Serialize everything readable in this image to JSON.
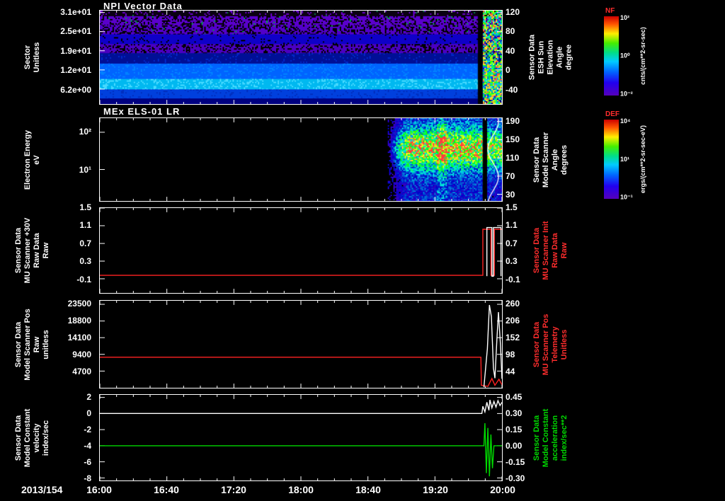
{
  "x_axis": {
    "date_label": "2013/154",
    "tick_labels": [
      "16:00",
      "16:40",
      "17:20",
      "18:00",
      "18:40",
      "19:20",
      "20:00"
    ],
    "start_hour": 16,
    "end_hour": 20
  },
  "colors": {
    "background": "#000000",
    "axis": "#ffffff",
    "red_label": "#ff2d2d",
    "green_label": "#00d800"
  },
  "colorbars": [
    {
      "name": "NF",
      "unit": "cnts/(cm**2-sr-sec)",
      "ticks": [
        {
          "label": "10²",
          "pos": 0.02
        },
        {
          "label": "10⁰",
          "pos": 0.5
        },
        {
          "label": "10⁻²",
          "pos": 0.98
        }
      ]
    },
    {
      "name": "DEF",
      "unit": "ergs/(cm**2-sr-sec-eV)",
      "ticks": [
        {
          "label": "10⁴",
          "pos": 0.02
        },
        {
          "label": "10¹",
          "pos": 0.5
        },
        {
          "label": "10⁻¹",
          "pos": 0.98
        }
      ]
    }
  ],
  "chart_data": [
    {
      "type": "heatmap",
      "title": "NPI Vector Data",
      "ylabel_lines": [
        "Sector",
        "Unitless"
      ],
      "right_label_lines": [
        "Sensor Data",
        "ESH Sun",
        "Elevation",
        "Angle",
        "degree"
      ],
      "right_color": "#ffffff",
      "left_ticks": [
        {
          "label": "3.1e+01",
          "pos": 0.02
        },
        {
          "label": "2.5e+01",
          "pos": 0.225
        },
        {
          "label": "1.9e+01",
          "pos": 0.43
        },
        {
          "label": "1.2e+01",
          "pos": 0.635
        },
        {
          "label": "6.2e+00",
          "pos": 0.84
        }
      ],
      "right_ticks": [
        {
          "label": "120",
          "pos": 0.02
        },
        {
          "label": "80",
          "pos": 0.225
        },
        {
          "label": "40",
          "pos": 0.43
        },
        {
          "label": "0",
          "pos": 0.635
        },
        {
          "label": "-40",
          "pos": 0.84
        }
      ],
      "bands": [
        {
          "y0": 0.0,
          "y1": 0.06,
          "color": "#0a0012",
          "speckles": [
            [
              "#6a00cc",
              0.14
            ],
            [
              "#008040",
              0.01
            ]
          ]
        },
        {
          "y0": 0.06,
          "y1": 0.16,
          "color": "#5a00cc",
          "speckles": [
            [
              "#000000",
              0.3
            ],
            [
              "#00a044",
              0.02
            ]
          ]
        },
        {
          "y0": 0.16,
          "y1": 0.25,
          "color": "#5200c8",
          "speckles": [
            [
              "#000000",
              0.36
            ],
            [
              "#00a044",
              0.012
            ]
          ]
        },
        {
          "y0": 0.25,
          "y1": 0.36,
          "color": "#0f00c8",
          "speckles": [
            [
              "#000000",
              0.06
            ]
          ]
        },
        {
          "y0": 0.36,
          "y1": 0.455,
          "color": "#4a00c0",
          "speckles": [
            [
              "#000000",
              0.3
            ]
          ]
        },
        {
          "y0": 0.455,
          "y1": 0.57,
          "color": "#000f96",
          "speckles": [
            [
              "#0028c8",
              0.1
            ]
          ]
        },
        {
          "y0": 0.57,
          "y1": 0.73,
          "color": "#0064ff",
          "speckles": [
            [
              "#0082ff",
              0.18
            ]
          ]
        },
        {
          "y0": 0.73,
          "y1": 0.845,
          "color": "#00b8f0",
          "speckles": [
            [
              "#45d8ff",
              0.25
            ]
          ]
        },
        {
          "y0": 0.845,
          "y1": 0.94,
          "color": "#0040dd",
          "speckles": [
            [
              "#002fc0",
              0.12
            ]
          ]
        },
        {
          "y0": 0.94,
          "y1": 1.0,
          "color": "#000080",
          "speckles": []
        }
      ],
      "gap": {
        "x0": 0.94,
        "x1": 0.952
      },
      "burst": {
        "x0": 0.952,
        "x1": 1.0
      }
    },
    {
      "type": "heatmap",
      "title": "MEx ELS-01 LR",
      "ylabel_lines": [
        "Electron Energy",
        "eV"
      ],
      "right_label_lines": [
        "Sensor Data",
        "Model Scanner",
        "Angle",
        "degrees"
      ],
      "right_color": "#ffffff",
      "left_ticks": [
        {
          "label": "10²",
          "pos": 0.17
        },
        {
          "label": "10¹",
          "pos": 0.62
        }
      ],
      "right_ticks": [
        {
          "label": "190",
          "pos": 0.04
        },
        {
          "label": "150",
          "pos": 0.26
        },
        {
          "label": "110",
          "pos": 0.48
        },
        {
          "label": "70",
          "pos": 0.7
        },
        {
          "label": "30",
          "pos": 0.92
        }
      ],
      "blob": {
        "x0": 0.715,
        "core_y": 0.36,
        "core_sy": 0.15,
        "boost_x": [
          0.838,
          0.862
        ],
        "gap": [
          0.952,
          0.963
        ],
        "white_line_x": 0.978
      }
    },
    {
      "type": "line",
      "ylabel_lines": [
        "Sensor Data",
        "MU Scanner +30V",
        "Raw Data",
        "Raw"
      ],
      "right_label_lines": [
        "Sensor Data",
        "MU Scanner Init",
        "Raw Data",
        "Raw"
      ],
      "right_color": "#ff2d2d",
      "ylim": [
        -0.42,
        1.5
      ],
      "left_ticks": [
        {
          "label": "1.5",
          "pos": 0.0
        },
        {
          "label": "1.1",
          "pos": 0.208
        },
        {
          "label": "0.7",
          "pos": 0.417
        },
        {
          "label": "0.3",
          "pos": 0.625
        },
        {
          "label": "-0.1",
          "pos": 0.833
        }
      ],
      "right_ticks": [
        {
          "label": "1.5",
          "pos": 0.0
        },
        {
          "label": "1.1",
          "pos": 0.208
        },
        {
          "label": "0.7",
          "pos": 0.417
        },
        {
          "label": "0.3",
          "pos": 0.625
        },
        {
          "label": "-0.1",
          "pos": 0.833
        }
      ],
      "series": [
        {
          "name": "mu-scanner-30v-raw",
          "color": "#ff2222",
          "points": [
            [
              16,
              -0.02
            ],
            [
              19.81,
              -0.02
            ],
            [
              19.81,
              1.02
            ],
            [
              19.89,
              1.02
            ],
            [
              19.89,
              -0.02
            ],
            [
              19.925,
              -0.02
            ],
            [
              19.925,
              1.02
            ],
            [
              20,
              1.02
            ]
          ]
        },
        {
          "name": "mu-scanner-init-raw",
          "color": "#ffffff",
          "points": [
            [
              19.85,
              -0.04
            ],
            [
              19.85,
              1.06
            ],
            [
              19.9,
              1.06
            ],
            [
              19.9,
              -0.04
            ],
            [
              19.915,
              -0.04
            ],
            [
              19.915,
              1.06
            ],
            [
              19.99,
              1.06
            ],
            [
              19.99,
              -0.04
            ]
          ]
        }
      ]
    },
    {
      "type": "line",
      "ylabel_lines": [
        "Sensor Data",
        "Model Scanner Pos",
        "Raw",
        "unitless"
      ],
      "right_label_lines": [
        "Sensor Data",
        "MU Scanner Pos",
        "Telemetry",
        "Unitless"
      ],
      "right_color": "#ff2d2d",
      "ylim": [
        0,
        24500
      ],
      "left_ticks": [
        {
          "label": "23500",
          "pos": 0.041
        },
        {
          "label": "18800",
          "pos": 0.233
        },
        {
          "label": "14100",
          "pos": 0.424
        },
        {
          "label": "9400",
          "pos": 0.616
        },
        {
          "label": "4700",
          "pos": 0.808
        }
      ],
      "right_ticks": [
        {
          "label": "260",
          "pos": 0.041
        },
        {
          "label": "206",
          "pos": 0.233
        },
        {
          "label": "152",
          "pos": 0.424
        },
        {
          "label": "98",
          "pos": 0.616
        },
        {
          "label": "44",
          "pos": 0.808
        }
      ],
      "series": [
        {
          "name": "model-scanner-pos-raw",
          "color": "#ff2222",
          "points": [
            [
              16,
              8600
            ],
            [
              19.79,
              8600
            ],
            [
              19.795,
              700
            ],
            [
              19.86,
              400
            ],
            [
              19.9,
              2600
            ],
            [
              19.93,
              700
            ],
            [
              19.97,
              2400
            ],
            [
              20,
              900
            ]
          ]
        },
        {
          "name": "mu-scanner-pos-telemetry",
          "color": "#ffffff",
          "points": [
            [
              19.82,
              200
            ],
            [
              19.855,
              11000
            ],
            [
              19.875,
              23300
            ],
            [
              19.895,
              20000
            ],
            [
              19.915,
              5500
            ],
            [
              19.93,
              2700
            ],
            [
              19.95,
              14000
            ],
            [
              19.965,
              21300
            ],
            [
              19.985,
              12000
            ],
            [
              20,
              2500
            ]
          ]
        }
      ]
    },
    {
      "type": "line",
      "ylabel_lines": [
        "Sensor Data",
        "Model Constant",
        "velocity",
        "index/sec"
      ],
      "right_label_lines": [
        "Sensor Data",
        "Model Constant",
        "acceleration",
        "index/sec**2"
      ],
      "right_color": "#00d800",
      "ylim": [
        -8.32,
        2.32
      ],
      "left_ticks": [
        {
          "label": "2",
          "pos": 0.03
        },
        {
          "label": "0",
          "pos": 0.218
        },
        {
          "label": "-2",
          "pos": 0.406
        },
        {
          "label": "-4",
          "pos": 0.594
        },
        {
          "label": "-6",
          "pos": 0.782
        },
        {
          "label": "-8",
          "pos": 0.97
        }
      ],
      "right_ticks": [
        {
          "label": "0.45",
          "pos": 0.03
        },
        {
          "label": "0.30",
          "pos": 0.218
        },
        {
          "label": "0.15",
          "pos": 0.406
        },
        {
          "label": "0.00",
          "pos": 0.594
        },
        {
          "label": "-0.15",
          "pos": 0.782
        },
        {
          "label": "-0.30",
          "pos": 0.97
        }
      ],
      "series": [
        {
          "name": "model-constant-velocity",
          "color": "#ffffff",
          "points": [
            [
              16,
              0
            ],
            [
              19.8,
              0
            ],
            [
              19.81,
              0.9
            ],
            [
              19.83,
              0.2
            ],
            [
              19.85,
              1.4
            ],
            [
              19.87,
              0.4
            ],
            [
              19.88,
              1.7
            ],
            [
              19.9,
              0.7
            ],
            [
              19.92,
              1.5
            ],
            [
              19.94,
              0.8
            ],
            [
              19.96,
              1.6
            ],
            [
              19.98,
              1.0
            ],
            [
              20,
              1.4
            ]
          ]
        },
        {
          "name": "model-constant-acceleration",
          "color": "#00d800",
          "points": [
            [
              16,
              -4
            ],
            [
              19.82,
              -4
            ],
            [
              19.83,
              -1.2
            ],
            [
              19.845,
              -7.4
            ],
            [
              19.86,
              -1.8
            ],
            [
              19.875,
              -7.8
            ],
            [
              19.89,
              -2.6
            ],
            [
              19.905,
              -6.8
            ],
            [
              19.92,
              -4
            ],
            [
              20,
              -4
            ]
          ]
        }
      ]
    }
  ]
}
